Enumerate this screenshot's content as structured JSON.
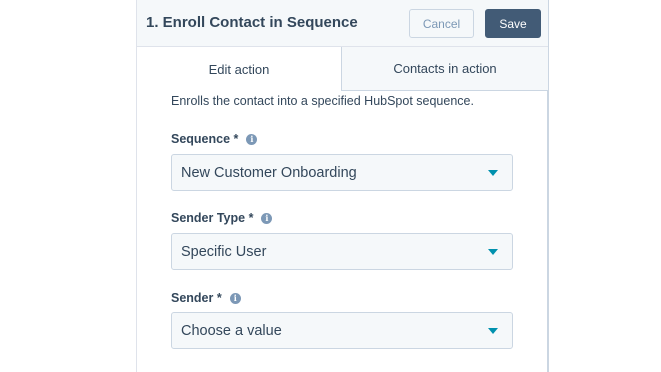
{
  "panel": {
    "title": "1. Enroll Contact in Sequence",
    "cancel_label": "Cancel",
    "save_label": "Save"
  },
  "tabs": [
    {
      "label": "Edit action",
      "active": true
    },
    {
      "label": "Contacts in action",
      "active": false
    }
  ],
  "description": "Enrolls the contact into a specified HubSpot sequence.",
  "fields": [
    {
      "label": "Sequence *",
      "value": "New Customer Onboarding",
      "info_icon": "info-icon"
    },
    {
      "label": "Sender Type *",
      "value": "Specific User",
      "info_icon": "info-icon"
    },
    {
      "label": "Sender *",
      "value": "Choose a value",
      "info_icon": "info-icon"
    }
  ],
  "colors": {
    "header_bg": "#f5f8fa",
    "save_bg": "#425b76",
    "text": "#33475b",
    "caret": "#0091ae"
  }
}
